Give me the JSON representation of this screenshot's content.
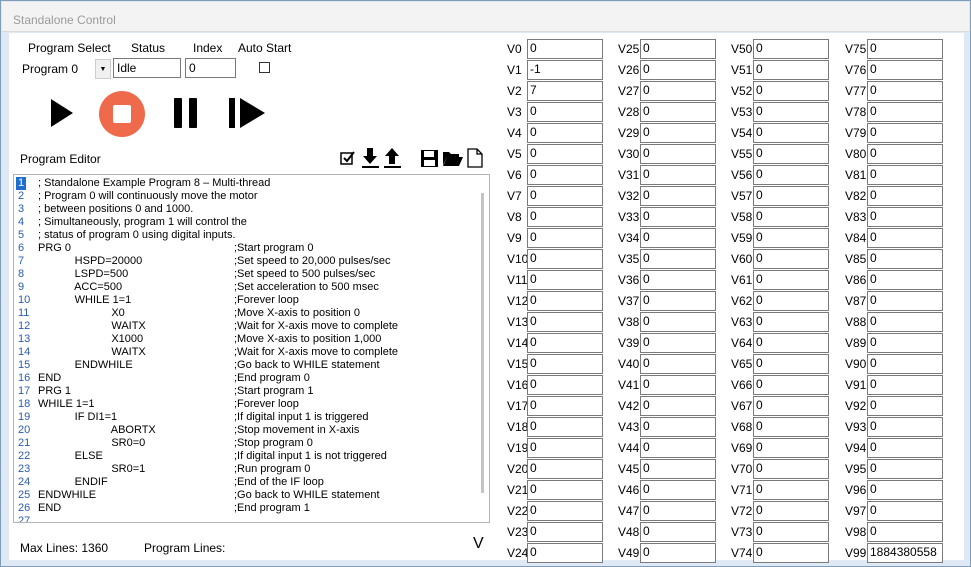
{
  "window": {
    "title": "Standalone Control"
  },
  "header": {
    "program_select_label": "Program Select",
    "status_label": "Status",
    "index_label": "Index",
    "auto_start_label": "Auto Start",
    "program_select_value": "Program 0",
    "status_value": "Idle",
    "index_value": "0",
    "auto_start_checked": false
  },
  "controls": {
    "icons": [
      "play-icon",
      "stop-icon",
      "pause-icon",
      "step-icon"
    ],
    "stop_color": "#ee6a4a"
  },
  "editor": {
    "title": "Program Editor",
    "toolbar_icons": [
      "check-icon",
      "download-icon",
      "upload-icon",
      "save-icon",
      "open-folder-icon",
      "new-file-icon"
    ],
    "lines": [
      {
        "n": "1",
        "code": "; Standalone Example Program 8 – Multi-thread",
        "comment": ""
      },
      {
        "n": "2",
        "code": "; Program 0 will continuously move the motor",
        "comment": ""
      },
      {
        "n": "3",
        "code": "; between positions 0 and 1000.",
        "comment": ""
      },
      {
        "n": "4",
        "code": "; Simultaneously, program 1 will control the",
        "comment": ""
      },
      {
        "n": "5",
        "code": "; status of program 0 using digital inputs.",
        "comment": ""
      },
      {
        "n": "6",
        "code": "PRG 0",
        "comment": ";Start program 0"
      },
      {
        "n": "7",
        "code": "            HSPD=20000",
        "comment": ";Set speed to 20,000 pulses/sec"
      },
      {
        "n": "8",
        "code": "            LSPD=500",
        "comment": ";Set speed to 500 pulses/sec"
      },
      {
        "n": "9",
        "code": "            ACC=500",
        "comment": ";Set acceleration to 500 msec"
      },
      {
        "n": "10",
        "code": "            WHILE 1=1",
        "comment": ";Forever loop"
      },
      {
        "n": "11",
        "code": "                        X0",
        "comment": ";Move X-axis to position 0"
      },
      {
        "n": "12",
        "code": "                        WAITX",
        "comment": ";Wait for X-axis move to complete"
      },
      {
        "n": "13",
        "code": "                        X1000",
        "comment": ";Move X-axis to position 1,000"
      },
      {
        "n": "14",
        "code": "                        WAITX",
        "comment": ";Wait for X-axis move to complete"
      },
      {
        "n": "15",
        "code": "            ENDWHILE",
        "comment": ";Go back to WHILE statement"
      },
      {
        "n": "16",
        "code": "END",
        "comment": ";End program 0"
      },
      {
        "n": "17",
        "code": "PRG 1",
        "comment": ";Start program 1"
      },
      {
        "n": "18",
        "code": "WHILE 1=1",
        "comment": ";Forever loop"
      },
      {
        "n": "19",
        "code": "            IF DI1=1",
        "comment": ";If digital input 1 is triggered"
      },
      {
        "n": "20",
        "code": "                        ABORTX",
        "comment": ";Stop movement in X-axis"
      },
      {
        "n": "21",
        "code": "                        SR0=0",
        "comment": ";Stop program 0"
      },
      {
        "n": "22",
        "code": "            ELSE",
        "comment": ";If digital input 1 is not triggered"
      },
      {
        "n": "23",
        "code": "                        SR0=1",
        "comment": ";Run program 0"
      },
      {
        "n": "24",
        "code": "            ENDIF",
        "comment": ";End of the IF loop"
      },
      {
        "n": "25",
        "code": "ENDWHILE",
        "comment": ";Go back to WHILE statement"
      },
      {
        "n": "26",
        "code": "END",
        "comment": ";End program 1"
      },
      {
        "n": "27",
        "code": "",
        "comment": ""
      }
    ]
  },
  "footer": {
    "max_lines": "Max Lines: 1360",
    "program_lines": "Program Lines:",
    "version_glyph": "V"
  },
  "variables": [
    {
      "name": "V0",
      "value": "0"
    },
    {
      "name": "V1",
      "value": "-1"
    },
    {
      "name": "V2",
      "value": "7"
    },
    {
      "name": "V3",
      "value": "0"
    },
    {
      "name": "V4",
      "value": "0"
    },
    {
      "name": "V5",
      "value": "0"
    },
    {
      "name": "V6",
      "value": "0"
    },
    {
      "name": "V7",
      "value": "0"
    },
    {
      "name": "V8",
      "value": "0"
    },
    {
      "name": "V9",
      "value": "0"
    },
    {
      "name": "V10",
      "value": "0"
    },
    {
      "name": "V11",
      "value": "0"
    },
    {
      "name": "V12",
      "value": "0"
    },
    {
      "name": "V13",
      "value": "0"
    },
    {
      "name": "V14",
      "value": "0"
    },
    {
      "name": "V15",
      "value": "0"
    },
    {
      "name": "V16",
      "value": "0"
    },
    {
      "name": "V17",
      "value": "0"
    },
    {
      "name": "V18",
      "value": "0"
    },
    {
      "name": "V19",
      "value": "0"
    },
    {
      "name": "V20",
      "value": "0"
    },
    {
      "name": "V21",
      "value": "0"
    },
    {
      "name": "V22",
      "value": "0"
    },
    {
      "name": "V23",
      "value": "0"
    },
    {
      "name": "V24",
      "value": "0"
    },
    {
      "name": "V25",
      "value": "0"
    },
    {
      "name": "V26",
      "value": "0"
    },
    {
      "name": "V27",
      "value": "0"
    },
    {
      "name": "V28",
      "value": "0"
    },
    {
      "name": "V29",
      "value": "0"
    },
    {
      "name": "V30",
      "value": "0"
    },
    {
      "name": "V31",
      "value": "0"
    },
    {
      "name": "V32",
      "value": "0"
    },
    {
      "name": "V33",
      "value": "0"
    },
    {
      "name": "V34",
      "value": "0"
    },
    {
      "name": "V35",
      "value": "0"
    },
    {
      "name": "V36",
      "value": "0"
    },
    {
      "name": "V37",
      "value": "0"
    },
    {
      "name": "V38",
      "value": "0"
    },
    {
      "name": "V39",
      "value": "0"
    },
    {
      "name": "V40",
      "value": "0"
    },
    {
      "name": "V41",
      "value": "0"
    },
    {
      "name": "V42",
      "value": "0"
    },
    {
      "name": "V43",
      "value": "0"
    },
    {
      "name": "V44",
      "value": "0"
    },
    {
      "name": "V45",
      "value": "0"
    },
    {
      "name": "V46",
      "value": "0"
    },
    {
      "name": "V47",
      "value": "0"
    },
    {
      "name": "V48",
      "value": "0"
    },
    {
      "name": "V49",
      "value": "0"
    },
    {
      "name": "V50",
      "value": "0"
    },
    {
      "name": "V51",
      "value": "0"
    },
    {
      "name": "V52",
      "value": "0"
    },
    {
      "name": "V53",
      "value": "0"
    },
    {
      "name": "V54",
      "value": "0"
    },
    {
      "name": "V55",
      "value": "0"
    },
    {
      "name": "V56",
      "value": "0"
    },
    {
      "name": "V57",
      "value": "0"
    },
    {
      "name": "V58",
      "value": "0"
    },
    {
      "name": "V59",
      "value": "0"
    },
    {
      "name": "V60",
      "value": "0"
    },
    {
      "name": "V61",
      "value": "0"
    },
    {
      "name": "V62",
      "value": "0"
    },
    {
      "name": "V63",
      "value": "0"
    },
    {
      "name": "V64",
      "value": "0"
    },
    {
      "name": "V65",
      "value": "0"
    },
    {
      "name": "V66",
      "value": "0"
    },
    {
      "name": "V67",
      "value": "0"
    },
    {
      "name": "V68",
      "value": "0"
    },
    {
      "name": "V69",
      "value": "0"
    },
    {
      "name": "V70",
      "value": "0"
    },
    {
      "name": "V71",
      "value": "0"
    },
    {
      "name": "V72",
      "value": "0"
    },
    {
      "name": "V73",
      "value": "0"
    },
    {
      "name": "V74",
      "value": "0"
    },
    {
      "name": "V75",
      "value": "0"
    },
    {
      "name": "V76",
      "value": "0"
    },
    {
      "name": "V77",
      "value": "0"
    },
    {
      "name": "V78",
      "value": "0"
    },
    {
      "name": "V79",
      "value": "0"
    },
    {
      "name": "V80",
      "value": "0"
    },
    {
      "name": "V81",
      "value": "0"
    },
    {
      "name": "V82",
      "value": "0"
    },
    {
      "name": "V83",
      "value": "0"
    },
    {
      "name": "V84",
      "value": "0"
    },
    {
      "name": "V85",
      "value": "0"
    },
    {
      "name": "V86",
      "value": "0"
    },
    {
      "name": "V87",
      "value": "0"
    },
    {
      "name": "V88",
      "value": "0"
    },
    {
      "name": "V89",
      "value": "0"
    },
    {
      "name": "V90",
      "value": "0"
    },
    {
      "name": "V91",
      "value": "0"
    },
    {
      "name": "V92",
      "value": "0"
    },
    {
      "name": "V93",
      "value": "0"
    },
    {
      "name": "V94",
      "value": "0"
    },
    {
      "name": "V95",
      "value": "0"
    },
    {
      "name": "V96",
      "value": "0"
    },
    {
      "name": "V97",
      "value": "0"
    },
    {
      "name": "V98",
      "value": "0"
    },
    {
      "name": "V99",
      "value": "1884380558"
    }
  ]
}
